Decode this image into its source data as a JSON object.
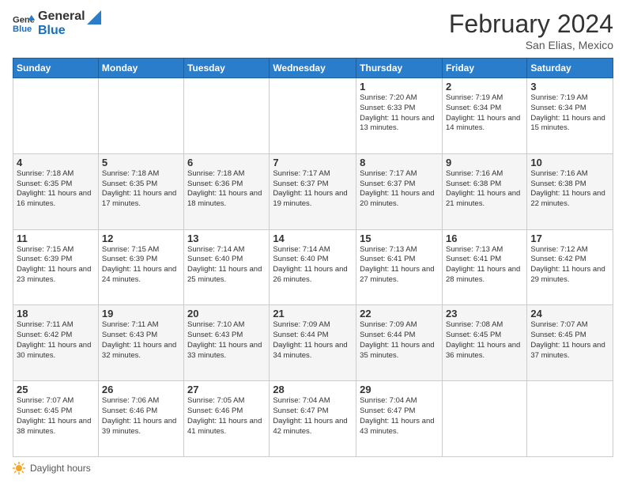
{
  "header": {
    "logo_line1": "General",
    "logo_line2": "Blue",
    "month_title": "February 2024",
    "subtitle": "San Elias, Mexico"
  },
  "weekdays": [
    "Sunday",
    "Monday",
    "Tuesday",
    "Wednesday",
    "Thursday",
    "Friday",
    "Saturday"
  ],
  "weeks": [
    [
      {
        "day": "",
        "info": ""
      },
      {
        "day": "",
        "info": ""
      },
      {
        "day": "",
        "info": ""
      },
      {
        "day": "",
        "info": ""
      },
      {
        "day": "1",
        "info": "Sunrise: 7:20 AM\nSunset: 6:33 PM\nDaylight: 11 hours and 13 minutes."
      },
      {
        "day": "2",
        "info": "Sunrise: 7:19 AM\nSunset: 6:34 PM\nDaylight: 11 hours and 14 minutes."
      },
      {
        "day": "3",
        "info": "Sunrise: 7:19 AM\nSunset: 6:34 PM\nDaylight: 11 hours and 15 minutes."
      }
    ],
    [
      {
        "day": "4",
        "info": "Sunrise: 7:18 AM\nSunset: 6:35 PM\nDaylight: 11 hours and 16 minutes."
      },
      {
        "day": "5",
        "info": "Sunrise: 7:18 AM\nSunset: 6:35 PM\nDaylight: 11 hours and 17 minutes."
      },
      {
        "day": "6",
        "info": "Sunrise: 7:18 AM\nSunset: 6:36 PM\nDaylight: 11 hours and 18 minutes."
      },
      {
        "day": "7",
        "info": "Sunrise: 7:17 AM\nSunset: 6:37 PM\nDaylight: 11 hours and 19 minutes."
      },
      {
        "day": "8",
        "info": "Sunrise: 7:17 AM\nSunset: 6:37 PM\nDaylight: 11 hours and 20 minutes."
      },
      {
        "day": "9",
        "info": "Sunrise: 7:16 AM\nSunset: 6:38 PM\nDaylight: 11 hours and 21 minutes."
      },
      {
        "day": "10",
        "info": "Sunrise: 7:16 AM\nSunset: 6:38 PM\nDaylight: 11 hours and 22 minutes."
      }
    ],
    [
      {
        "day": "11",
        "info": "Sunrise: 7:15 AM\nSunset: 6:39 PM\nDaylight: 11 hours and 23 minutes."
      },
      {
        "day": "12",
        "info": "Sunrise: 7:15 AM\nSunset: 6:39 PM\nDaylight: 11 hours and 24 minutes."
      },
      {
        "day": "13",
        "info": "Sunrise: 7:14 AM\nSunset: 6:40 PM\nDaylight: 11 hours and 25 minutes."
      },
      {
        "day": "14",
        "info": "Sunrise: 7:14 AM\nSunset: 6:40 PM\nDaylight: 11 hours and 26 minutes."
      },
      {
        "day": "15",
        "info": "Sunrise: 7:13 AM\nSunset: 6:41 PM\nDaylight: 11 hours and 27 minutes."
      },
      {
        "day": "16",
        "info": "Sunrise: 7:13 AM\nSunset: 6:41 PM\nDaylight: 11 hours and 28 minutes."
      },
      {
        "day": "17",
        "info": "Sunrise: 7:12 AM\nSunset: 6:42 PM\nDaylight: 11 hours and 29 minutes."
      }
    ],
    [
      {
        "day": "18",
        "info": "Sunrise: 7:11 AM\nSunset: 6:42 PM\nDaylight: 11 hours and 30 minutes."
      },
      {
        "day": "19",
        "info": "Sunrise: 7:11 AM\nSunset: 6:43 PM\nDaylight: 11 hours and 32 minutes."
      },
      {
        "day": "20",
        "info": "Sunrise: 7:10 AM\nSunset: 6:43 PM\nDaylight: 11 hours and 33 minutes."
      },
      {
        "day": "21",
        "info": "Sunrise: 7:09 AM\nSunset: 6:44 PM\nDaylight: 11 hours and 34 minutes."
      },
      {
        "day": "22",
        "info": "Sunrise: 7:09 AM\nSunset: 6:44 PM\nDaylight: 11 hours and 35 minutes."
      },
      {
        "day": "23",
        "info": "Sunrise: 7:08 AM\nSunset: 6:45 PM\nDaylight: 11 hours and 36 minutes."
      },
      {
        "day": "24",
        "info": "Sunrise: 7:07 AM\nSunset: 6:45 PM\nDaylight: 11 hours and 37 minutes."
      }
    ],
    [
      {
        "day": "25",
        "info": "Sunrise: 7:07 AM\nSunset: 6:45 PM\nDaylight: 11 hours and 38 minutes."
      },
      {
        "day": "26",
        "info": "Sunrise: 7:06 AM\nSunset: 6:46 PM\nDaylight: 11 hours and 39 minutes."
      },
      {
        "day": "27",
        "info": "Sunrise: 7:05 AM\nSunset: 6:46 PM\nDaylight: 11 hours and 41 minutes."
      },
      {
        "day": "28",
        "info": "Sunrise: 7:04 AM\nSunset: 6:47 PM\nDaylight: 11 hours and 42 minutes."
      },
      {
        "day": "29",
        "info": "Sunrise: 7:04 AM\nSunset: 6:47 PM\nDaylight: 11 hours and 43 minutes."
      },
      {
        "day": "",
        "info": ""
      },
      {
        "day": "",
        "info": ""
      }
    ]
  ],
  "footer": {
    "daylight_label": "Daylight hours"
  }
}
